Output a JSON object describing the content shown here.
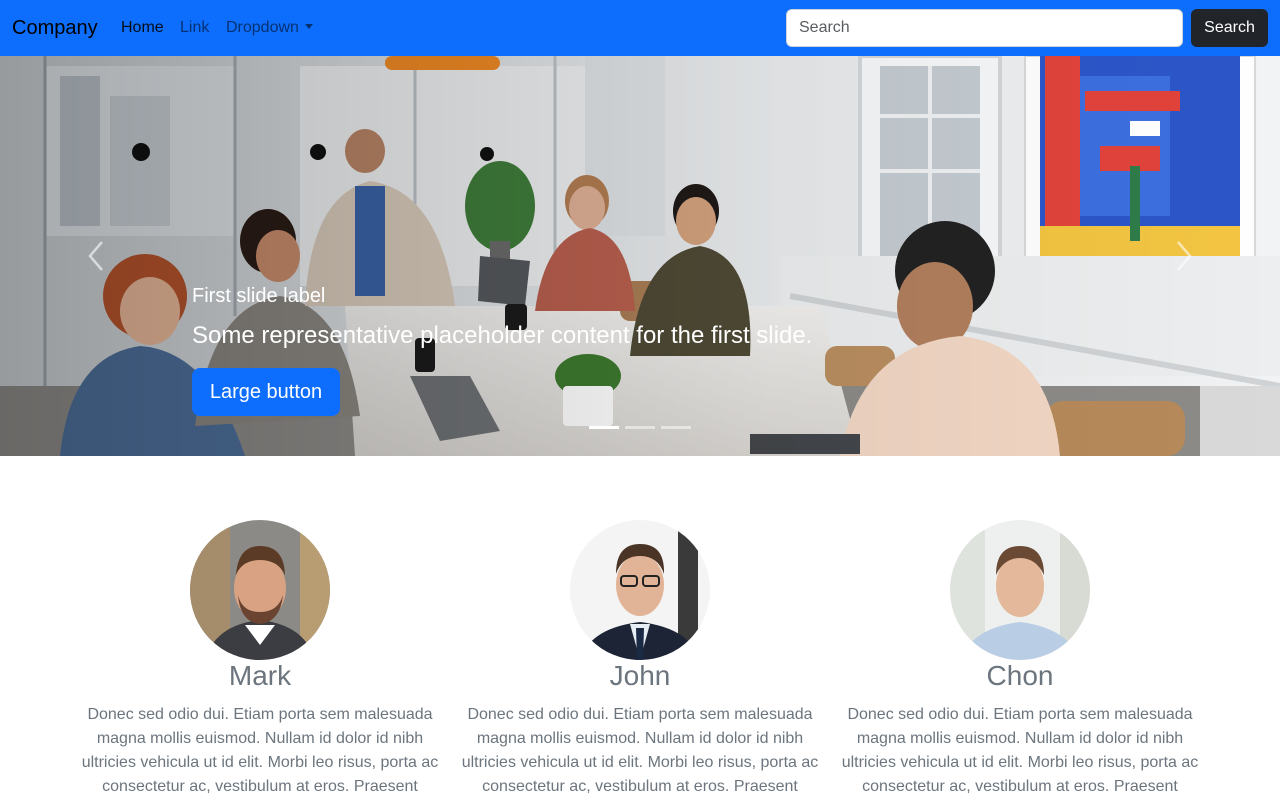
{
  "navbar": {
    "brand": "Company",
    "links": [
      {
        "label": "Home",
        "active": true
      },
      {
        "label": "Link",
        "active": false
      },
      {
        "label": "Dropdown",
        "active": false
      }
    ],
    "search": {
      "placeholder": "Search",
      "value": ""
    },
    "search_button": "Search",
    "background_color": "#0d6efd"
  },
  "carousel": {
    "slide": {
      "title": "First slide label",
      "text": "Some representative placeholder content for the first slide.",
      "button_label": "Large button"
    },
    "indicators": 3,
    "active_indicator": 0,
    "prev_icon": "chevron-left-icon",
    "next_icon": "chevron-right-icon"
  },
  "team": [
    {
      "name": "Mark",
      "bio": "Donec sed odio dui. Etiam porta sem malesuada magna mollis euismod. Nullam id dolor id nibh ultricies vehicula ut id elit. Morbi leo risus, porta ac consectetur ac, vestibulum at eros. Praesent"
    },
    {
      "name": "John",
      "bio": "Donec sed odio dui. Etiam porta sem malesuada magna mollis euismod. Nullam id dolor id nibh ultricies vehicula ut id elit. Morbi leo risus, porta ac consectetur ac, vestibulum at eros. Praesent"
    },
    {
      "name": "Chon",
      "bio": "Donec sed odio dui. Etiam porta sem malesuada magna mollis euismod. Nullam id dolor id nibh ultricies vehicula ut id elit. Morbi leo risus, porta ac consectetur ac, vestibulum at eros. Praesent"
    }
  ]
}
